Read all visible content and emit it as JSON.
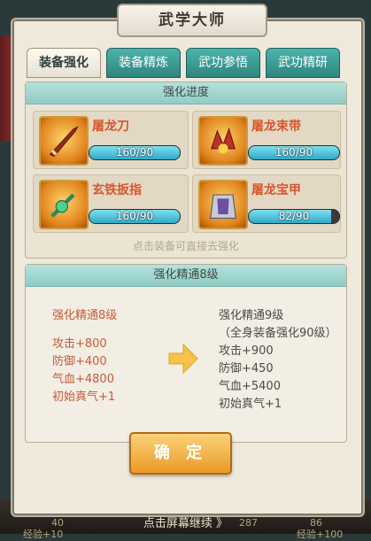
{
  "title": "武学大师",
  "tabs": [
    "装备强化",
    "装备精炼",
    "武功参悟",
    "武功精研"
  ],
  "progress": {
    "header": "强化进度",
    "items": [
      {
        "name": "屠龙刀",
        "progress_text": "160/90",
        "fill": 1.0,
        "icon": "saber-icon"
      },
      {
        "name": "屠龙束带",
        "progress_text": "160/90",
        "fill": 1.0,
        "icon": "belt-icon"
      },
      {
        "name": "玄铁扳指",
        "progress_text": "160/90",
        "fill": 1.0,
        "icon": "ring-icon"
      },
      {
        "name": "屠龙宝甲",
        "progress_text": "82/90",
        "fill": 0.91,
        "icon": "armor-icon"
      }
    ],
    "hint": "点击装备可直接去强化"
  },
  "mastery": {
    "header": "强化精通8级",
    "current": {
      "title": "强化精通8级",
      "stats": [
        "攻击+800",
        "防御+400",
        "气血+4800",
        "初始真气+1"
      ]
    },
    "next": {
      "title": "强化精通9级",
      "subtitle": "（全身装备强化90级）",
      "stats": [
        "攻击+900",
        "防御+450",
        "气血+5400",
        "初始真气+1"
      ]
    }
  },
  "confirm_label": "确 定",
  "continue_text": "点击屏幕继续 》",
  "background_stats": [
    "40",
    "经验+10",
    "287",
    "86",
    "经验+100"
  ],
  "colors": {
    "accent_teal": "#4bb3ab",
    "stat_red": "#c65a3a",
    "confirm_orange": "#e99a26"
  }
}
